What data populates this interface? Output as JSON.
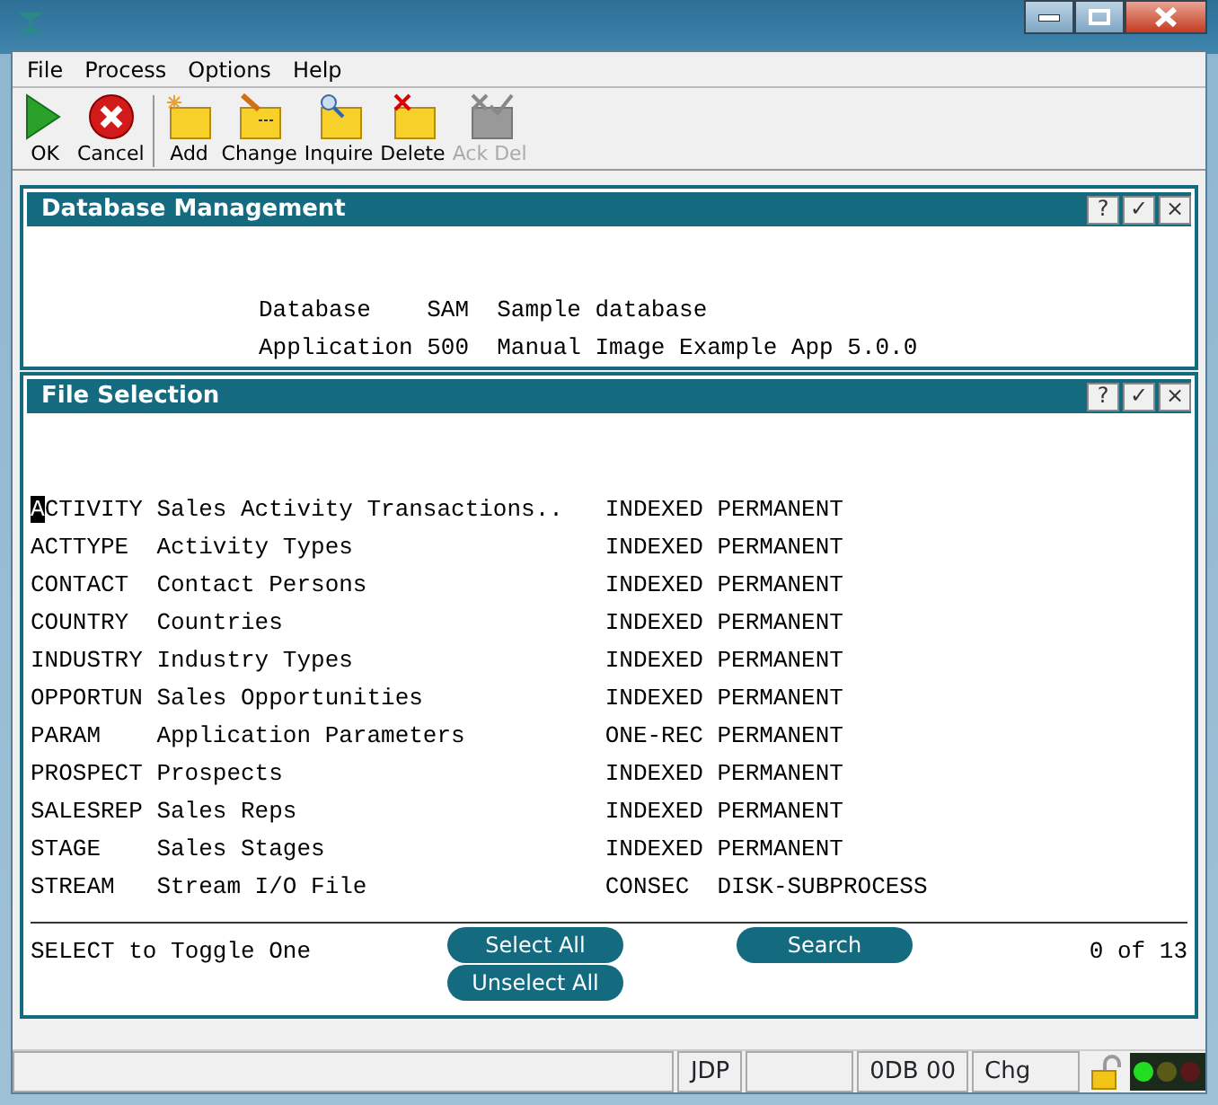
{
  "menu": [
    "File",
    "Process",
    "Options",
    "Help"
  ],
  "toolbar": [
    {
      "label": "OK",
      "kind": "ok",
      "disabled": false
    },
    {
      "label": "Cancel",
      "kind": "cancel",
      "disabled": false
    },
    {
      "label": "Add",
      "kind": "add",
      "disabled": false
    },
    {
      "label": "Change",
      "kind": "change",
      "disabled": false
    },
    {
      "label": "Inquire",
      "kind": "inquire",
      "disabled": false
    },
    {
      "label": "Delete",
      "kind": "delete",
      "disabled": false
    },
    {
      "label": "Ack Del",
      "kind": "ackdel",
      "disabled": true
    }
  ],
  "database_panel": {
    "title": "Database Management",
    "header_buttons": [
      "?",
      "✓",
      "×"
    ],
    "lines": [
      {
        "label": "Database",
        "code": "SAM",
        "description": "Sample database"
      },
      {
        "label": "Application",
        "code": "500",
        "description": "Manual Image Example App 5.0.0"
      }
    ]
  },
  "file_panel": {
    "title": "File Selection",
    "header_buttons": [
      "?",
      "✓",
      "×"
    ],
    "rows": [
      {
        "name": "ACTIVITY",
        "description": "Sales Activity Transactions..",
        "organization": "INDEXED",
        "type": "PERMANENT",
        "cursor": true
      },
      {
        "name": "ACTTYPE",
        "description": "Activity Types",
        "organization": "INDEXED",
        "type": "PERMANENT",
        "cursor": false
      },
      {
        "name": "CONTACT",
        "description": "Contact Persons",
        "organization": "INDEXED",
        "type": "PERMANENT",
        "cursor": false
      },
      {
        "name": "COUNTRY",
        "description": "Countries",
        "organization": "INDEXED",
        "type": "PERMANENT",
        "cursor": false
      },
      {
        "name": "INDUSTRY",
        "description": "Industry Types",
        "organization": "INDEXED",
        "type": "PERMANENT",
        "cursor": false
      },
      {
        "name": "OPPORTUN",
        "description": "Sales Opportunities",
        "organization": "INDEXED",
        "type": "PERMANENT",
        "cursor": false
      },
      {
        "name": "PARAM",
        "description": "Application Parameters",
        "organization": "ONE-REC",
        "type": "PERMANENT",
        "cursor": false
      },
      {
        "name": "PROSPECT",
        "description": "Prospects",
        "organization": "INDEXED",
        "type": "PERMANENT",
        "cursor": false
      },
      {
        "name": "SALESREP",
        "description": "Sales Reps",
        "organization": "INDEXED",
        "type": "PERMANENT",
        "cursor": false
      },
      {
        "name": "STAGE",
        "description": "Sales Stages",
        "organization": "INDEXED",
        "type": "PERMANENT",
        "cursor": false
      },
      {
        "name": "STREAM",
        "description": "Stream I/O File",
        "organization": "CONSEC",
        "type": "DISK-SUBPROCESS",
        "cursor": false
      }
    ],
    "hint": "SELECT to Toggle One",
    "select_all": "Select All",
    "unselect_all": "Unselect All",
    "search": "Search",
    "count": "0 of 13"
  },
  "status_bar": {
    "user": "JDP",
    "code": "0DB 00",
    "mode": "Chg",
    "lights": [
      {
        "color": "#22dd22"
      },
      {
        "color": "#5a5a18"
      },
      {
        "color": "#5a1818"
      }
    ]
  }
}
